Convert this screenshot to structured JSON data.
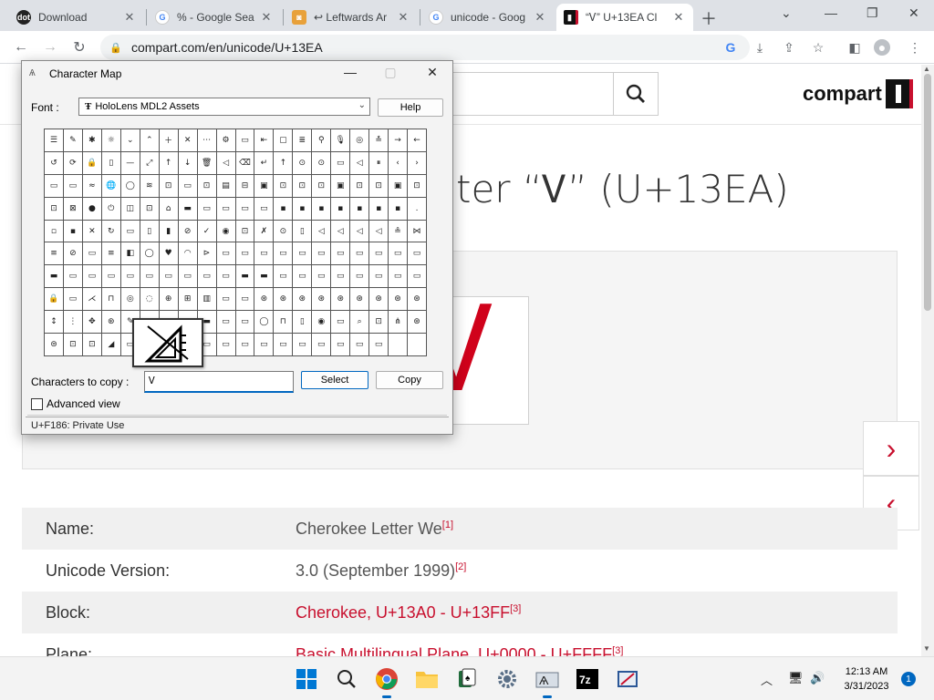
{
  "browser": {
    "tabs": [
      {
        "title": "Download",
        "favicon": "dot"
      },
      {
        "title": "% - Google Sea",
        "favicon": "G"
      },
      {
        "title": "↩ Leftwards Ar",
        "favicon": "fileformat"
      },
      {
        "title": "unicode - Goog",
        "favicon": "G"
      },
      {
        "title": "“Ꮩ” U+13EA Cl",
        "favicon": "compart"
      }
    ],
    "url": "compart.com/en/unicode/U+13EA"
  },
  "page": {
    "title": "ter “Ꮩ” (U+13EA)",
    "glyph": "Ꮩ",
    "rows": [
      {
        "key": "Name:",
        "value": "Cherokee Letter We",
        "ref": "[1]"
      },
      {
        "key": "Unicode Version:",
        "value": "3.0 (September 1999)",
        "ref": "[2]"
      },
      {
        "key": "Block:",
        "value": "Cherokee, U+13A0 - U+13FF",
        "ref": "[3]"
      },
      {
        "key": "Plane:",
        "value": "Basic Multilingual Plane, U+0000 - U+FFFF",
        "ref": "[3]"
      }
    ],
    "logo": "compart"
  },
  "charmap": {
    "title": "Character Map",
    "font_label": "Font :",
    "font_value": "HoloLens MDL2 Assets",
    "help_label": "Help",
    "copy_label": "Characters to copy :",
    "copy_value": "Ꮩ",
    "select_label": "Select",
    "copy_button_label": "Copy",
    "advanced_label": "Advanced view",
    "status": "U+F186: Private Use",
    "grid_glyphs": "☰✎✱☼⌄⌃＋✕⋯⚙▭⇤▢≣⚲🎙◎≛→←↺⟳🔒▯—⤢↑↓🗑◁⌫↵↑⊙⊙▭◁⏸‹›▭▭≈🌐◯≋⊡▭⊡▤⊟▣⊡⊡⊡▣⊡⊡▣⊡⊡⊠●⏻◫⊡⌂▬▭▭▭▭▪▪▪▪▪▪▪.▫▪✕↻▭▯▮⊘✓◉⊡✗⊙▯◁◁◁◁≗⋈≡⊘▭≡◧◯♥◠⊳▭▭▭▭▭▭▭▭▭▭▭▬▭▭▭▭▭▭▭▭▭▬▬▭▭▭▭▭▭▭▭🔒▭⋌⊓◎◌⊕⊞▥▭▭⊛⊛⊛⊛⊛⊛⊛⊛⊛↕⋮✥⊛✎◆▬▬▬▭▭◯⊓▯◉▭⌕⊡⋔⊛⊜⊡⊡◢▭▭▭▭▭▭▭▭▭▭▭▭▭▭"
  },
  "taskbar": {
    "time": "12:13 AM",
    "date": "3/31/2023",
    "notifications": "1"
  }
}
